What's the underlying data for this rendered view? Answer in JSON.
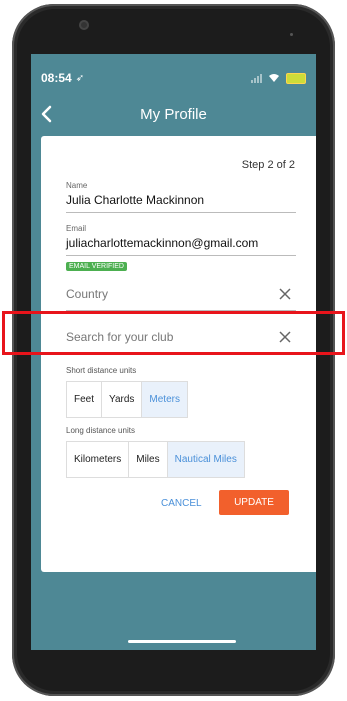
{
  "status_bar": {
    "time": "08:54",
    "location_glyph": "➶"
  },
  "app_bar": {
    "title": "My Profile"
  },
  "form": {
    "step_text": "Step 2 of 2",
    "name": {
      "label": "Name",
      "value": "Julia Charlotte Mackinnon"
    },
    "email": {
      "label": "Email",
      "value": "juliacharlottemackinnon@gmail.com",
      "badge": "EMAIL VERIFIED"
    },
    "country": {
      "placeholder": "Country"
    },
    "club": {
      "placeholder": "Search for your club"
    },
    "short_distance": {
      "label": "Short distance units",
      "options": [
        "Feet",
        "Yards",
        "Meters"
      ],
      "selected": "Meters"
    },
    "long_distance": {
      "label": "Long distance units",
      "options": [
        "Kilometers",
        "Miles",
        "Nautical Miles"
      ],
      "selected": "Nautical Miles"
    },
    "cancel_label": "CANCEL",
    "update_label": "UPDATE"
  },
  "colors": {
    "screen_bg": "#4e8895",
    "accent_blue": "#4a90d9",
    "update_button": "#f2602c",
    "verified_badge": "#4caf50",
    "highlight_box": "#e8141b"
  }
}
